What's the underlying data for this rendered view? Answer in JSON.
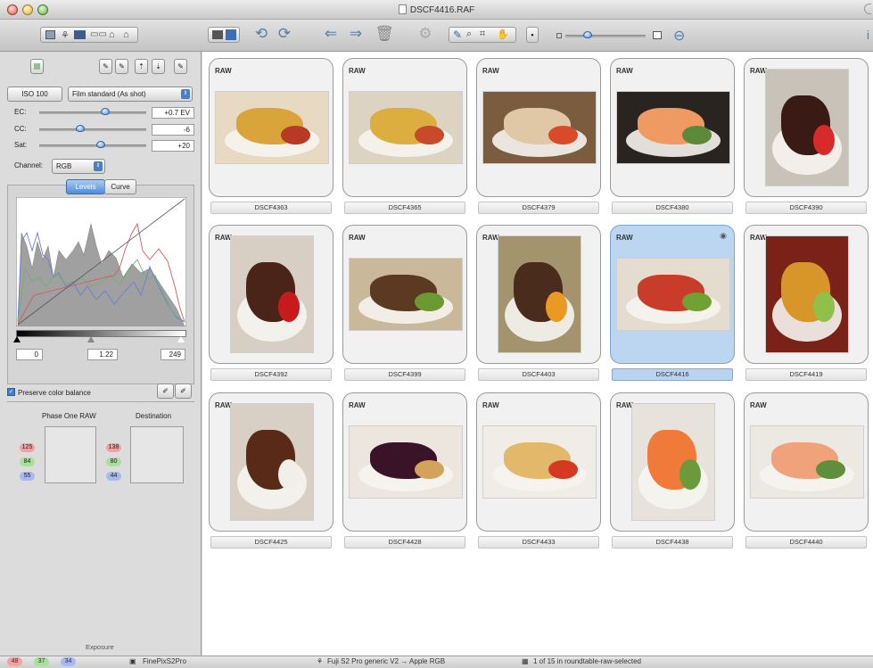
{
  "window": {
    "title": "DSCF4416.RAF"
  },
  "sidebar": {
    "iso": "ISO 100",
    "film_mode": "Film standard (As shot)",
    "ec_label": "EC:",
    "ec_value": "+0.7 EV",
    "cc_label": "CC:",
    "cc_value": "-6",
    "sat_label": "Sat:",
    "sat_value": "+20",
    "channel_label": "Channel:",
    "channel_value": "RGB",
    "tab_levels": "Levels",
    "tab_curve": "Curve",
    "level_black": "0",
    "level_gamma": "1.22",
    "level_white": "249",
    "preserve_label": "Preserve color balance",
    "phase_one_label": "Phase One RAW",
    "destination_label": "Destination",
    "phase_rgb": [
      "125",
      "84",
      "55"
    ],
    "dest_rgb": [
      "138",
      "80",
      "44"
    ],
    "exposure_label": "Exposure",
    "colors": {
      "red_pill": "#f3a0a0",
      "green_pill": "#a6e09a",
      "blue_pill": "#a7b9f0"
    }
  },
  "status": {
    "rgb": [
      "48",
      "37",
      "34"
    ],
    "camera": "FinePixS2Pro",
    "profile": "Fuji S2 Pro generic V2 → Apple RGB",
    "selection": "1 of 15 in roundtable-raw-selected"
  },
  "browser": {
    "badge": "RAW",
    "selected": "DSCF4416",
    "items": [
      {
        "name": "DSCF4363",
        "bg": "#e8d9c2",
        "food": "#d9a53a",
        "accent": "#b83a24"
      },
      {
        "name": "DSCF4365",
        "bg": "#ddd3c3",
        "food": "#dcad3f",
        "accent": "#c84a2a"
      },
      {
        "name": "DSCF4379",
        "bg": "#7a5c3e",
        "food": "#e0c8a6",
        "accent": "#d84a2a"
      },
      {
        "name": "DSCF4380",
        "bg": "#2a2420",
        "food": "#ef9a62",
        "accent": "#5a8a3a"
      },
      {
        "name": "DSCF4390",
        "bg": "#c9c2b8",
        "food": "#3a1a14",
        "accent": "#d82a2a"
      },
      {
        "name": "DSCF4392",
        "bg": "#d8cfc4",
        "food": "#4a2418",
        "accent": "#c81a1a"
      },
      {
        "name": "DSCF4399",
        "bg": "#c9b99a",
        "food": "#5c3a22",
        "accent": "#6c9a32"
      },
      {
        "name": "DSCF4403",
        "bg": "#a4946e",
        "food": "#4a2c1c",
        "accent": "#ea9a22"
      },
      {
        "name": "DSCF4416",
        "bg": "#e3dccf",
        "food": "#c93c2a",
        "accent": "#6fa232"
      },
      {
        "name": "DSCF4419",
        "bg": "#7a2218",
        "food": "#d8952a",
        "accent": "#8fc04a"
      },
      {
        "name": "DSCF4425",
        "bg": "#d8d0c4",
        "food": "#5a2a18",
        "accent": "#f2eee8"
      },
      {
        "name": "DSCF4428",
        "bg": "#ece6de",
        "food": "#3a1426",
        "accent": "#d4a25a"
      },
      {
        "name": "DSCF4433",
        "bg": "#f0ece6",
        "food": "#e3b86a",
        "accent": "#d43a22"
      },
      {
        "name": "DSCF4438",
        "bg": "#e7e3dc",
        "food": "#ef7a3a",
        "accent": "#6a9a3a"
      },
      {
        "name": "DSCF4440",
        "bg": "#ece8e2",
        "food": "#f0a27a",
        "accent": "#5f8f3a"
      }
    ]
  }
}
